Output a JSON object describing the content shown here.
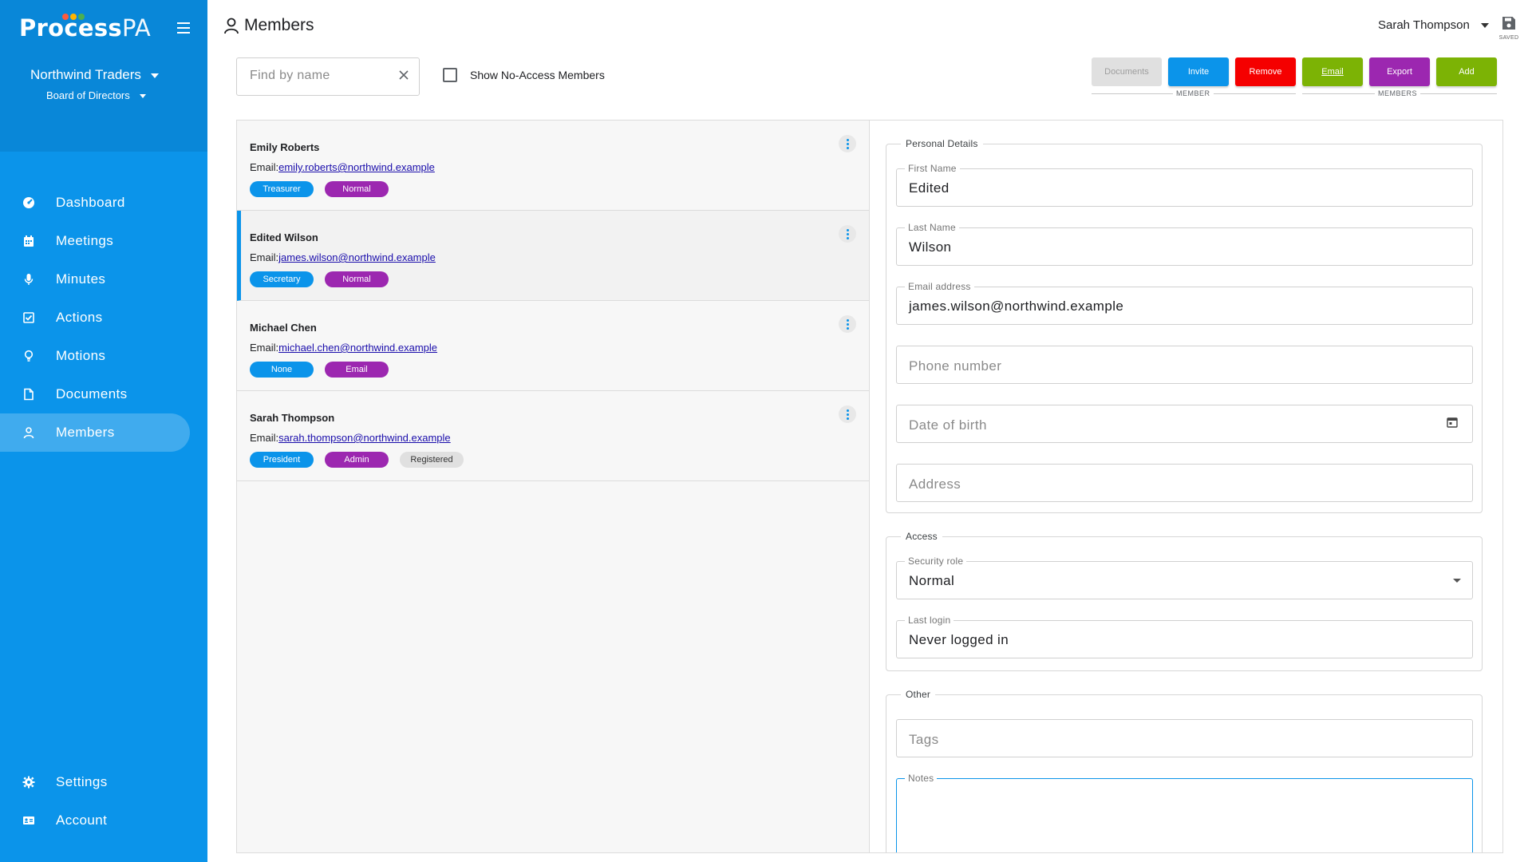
{
  "app": {
    "logo_bold": "Process",
    "logo_light": "PA",
    "logo_dot_colors": [
      "#ff5a3c",
      "#ffb400",
      "#4caf50"
    ]
  },
  "sidebar": {
    "organization": "Northwind Traders",
    "board": "Board of Directors",
    "items": [
      {
        "label": "Dashboard",
        "icon": "dashboard-icon"
      },
      {
        "label": "Meetings",
        "icon": "calendar-icon"
      },
      {
        "label": "Minutes",
        "icon": "microphone-icon"
      },
      {
        "label": "Actions",
        "icon": "checkbox-icon"
      },
      {
        "label": "Motions",
        "icon": "lightbulb-icon"
      },
      {
        "label": "Documents",
        "icon": "document-icon"
      },
      {
        "label": "Members",
        "icon": "person-icon",
        "active": true
      }
    ],
    "bottom_items": [
      {
        "label": "Settings",
        "icon": "gear-icon"
      },
      {
        "label": "Account",
        "icon": "id-card-icon"
      }
    ]
  },
  "header": {
    "title": "Members",
    "user_name": "Sarah Thompson",
    "save_label": "SAVED"
  },
  "toolbar": {
    "search_placeholder": "Find by name",
    "show_no_access_label": "Show No-Access Members",
    "show_no_access_checked": false,
    "buttons": {
      "documents": "Documents",
      "invite": "Invite",
      "remove": "Remove",
      "email": "Email",
      "export": "Export",
      "add": "Add"
    },
    "group_member_label": "MEMBER",
    "group_members_label": "MEMBERS"
  },
  "colors": {
    "primary": "#0b94ea",
    "role_tag": "#0b94ea",
    "security_tag": "#9c27b0",
    "registered_tag": "#e0e0e0",
    "remove": "#f50000",
    "email": "#7cb305",
    "export": "#9c27b0",
    "add": "#7cb305",
    "documents_disabled": "#e0e0e0"
  },
  "members": [
    {
      "name": "Emily Roberts",
      "email_label": "Email:",
      "email": "emily.roberts@northwind.example",
      "role": "Treasurer",
      "security": "Normal"
    },
    {
      "name": "Edited Wilson",
      "email_label": "Email:",
      "email": "james.wilson@northwind.example",
      "role": "Secretary",
      "security": "Normal",
      "selected": true
    },
    {
      "name": "Michael Chen",
      "email_label": "Email:",
      "email": "michael.chen@northwind.example",
      "role": "None",
      "security": "Email"
    },
    {
      "name": "Sarah Thompson",
      "email_label": "Email:",
      "email": "sarah.thompson@northwind.example",
      "role": "President",
      "security": "Admin",
      "status": "Registered"
    }
  ],
  "details": {
    "personal": {
      "legend": "Personal Details",
      "first_name_label": "First Name",
      "first_name": "Edited",
      "last_name_label": "Last Name",
      "last_name": "Wilson",
      "email_label": "Email address",
      "email": "james.wilson@northwind.example",
      "phone_placeholder": "Phone number",
      "dob_placeholder": "Date of birth",
      "address_placeholder": "Address"
    },
    "access": {
      "legend": "Access",
      "security_role_label": "Security role",
      "security_role": "Normal",
      "last_login_label": "Last login",
      "last_login": "Never logged in"
    },
    "other": {
      "legend": "Other",
      "tags_placeholder": "Tags",
      "notes_label": "Notes",
      "notes": ""
    }
  }
}
